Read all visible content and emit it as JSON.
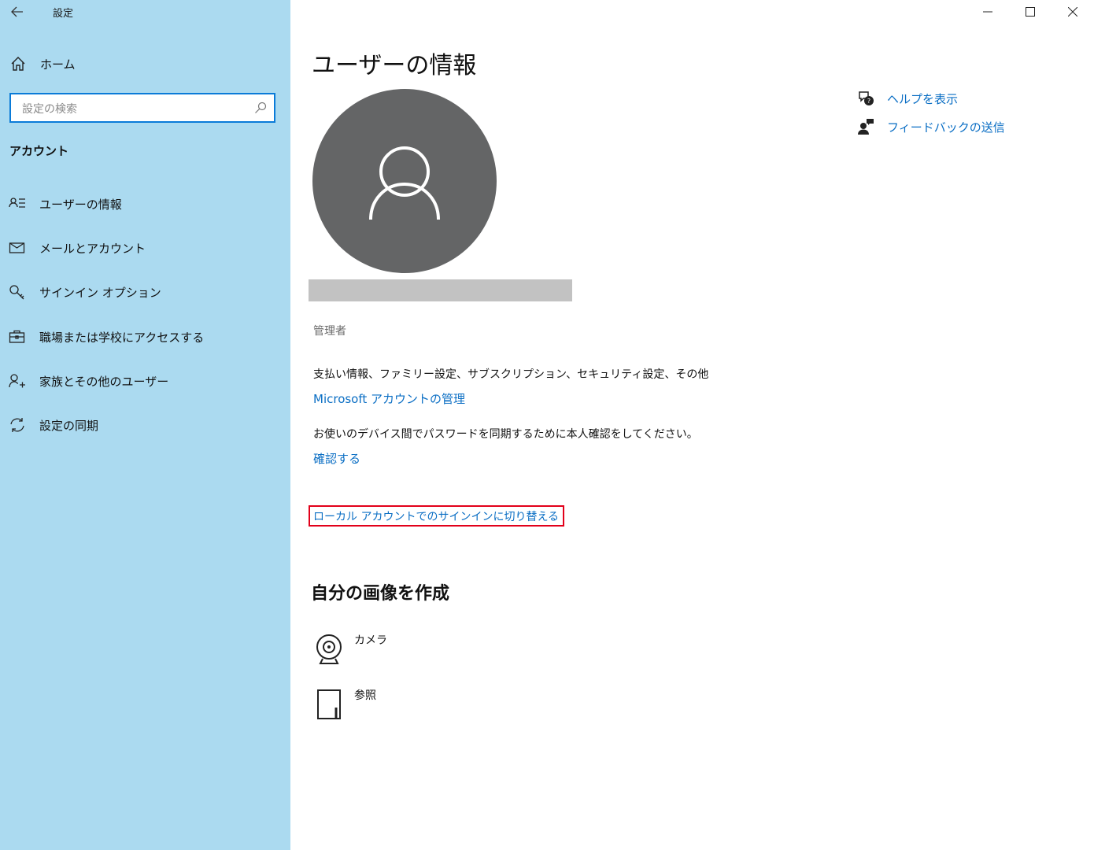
{
  "window": {
    "title": "設定",
    "controls": {
      "minimize": "minimize-icon",
      "maximize": "maximize-icon",
      "close": "close-icon"
    }
  },
  "sidebar": {
    "home_label": "ホーム",
    "search_placeholder": "設定の検索",
    "section_label": "アカウント",
    "items": [
      {
        "label": "ユーザーの情報",
        "icon": "user-info-icon"
      },
      {
        "label": "メールとアカウント",
        "icon": "mail-icon"
      },
      {
        "label": "サインイン オプション",
        "icon": "key-icon"
      },
      {
        "label": "職場または学校にアクセスする",
        "icon": "briefcase-icon"
      },
      {
        "label": "家族とその他のユーザー",
        "icon": "add-user-icon"
      },
      {
        "label": "設定の同期",
        "icon": "sync-icon"
      }
    ]
  },
  "main": {
    "title": "ユーザーの情報",
    "role": "管理者",
    "billing_text": "支払い情報、ファミリー設定、サブスクリプション、セキュリティ設定、その他",
    "manage_link": "Microsoft アカウントの管理",
    "verify_text": "お使いのデバイス間でパスワードを同期するために本人確認をしてください。",
    "verify_link": "確認する",
    "switch_link": "ローカル アカウントでのサインインに切り替える",
    "create_picture_title": "自分の画像を作成",
    "picture_options": [
      {
        "label": "カメラ",
        "icon": "camera-icon"
      },
      {
        "label": "参照",
        "icon": "browse-icon"
      }
    ]
  },
  "help": {
    "show_help": "ヘルプを表示",
    "send_feedback": "フィードバックの送信"
  },
  "colors": {
    "sidebar_bg": "#abdaf0",
    "link": "#0a6ec4",
    "highlight_border": "#e2001a",
    "avatar_bg": "#646566"
  }
}
